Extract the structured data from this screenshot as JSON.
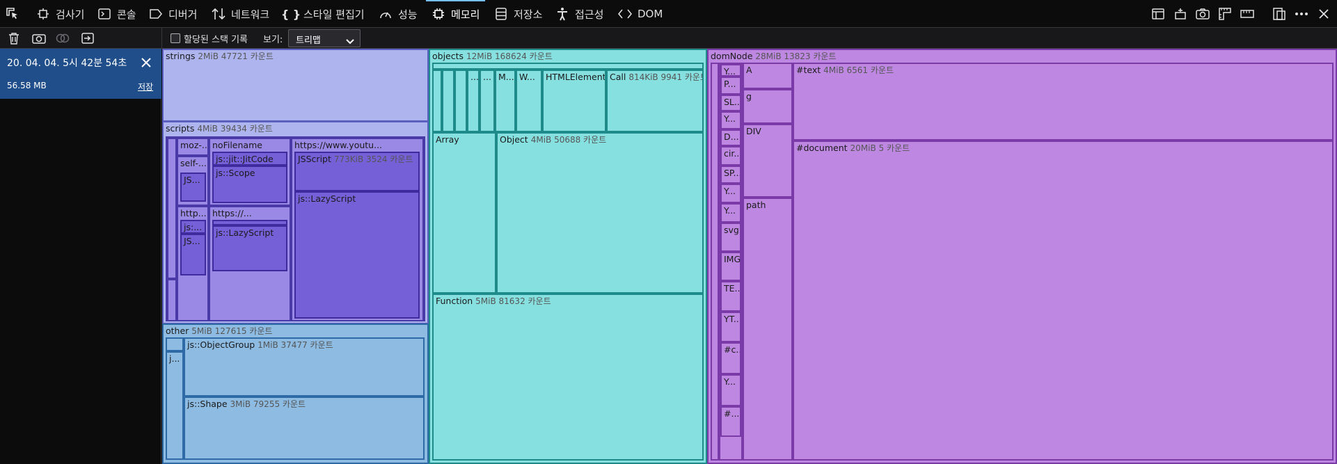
{
  "toolbar": {
    "tabs": [
      {
        "label": "검사기",
        "icon": "inspector-icon"
      },
      {
        "label": "콘솔",
        "icon": "console-icon"
      },
      {
        "label": "디버거",
        "icon": "debugger-icon"
      },
      {
        "label": "네트워크",
        "icon": "network-icon"
      },
      {
        "label": "스타일 편집기",
        "icon": "style-editor-icon"
      },
      {
        "label": "성능",
        "icon": "performance-icon"
      },
      {
        "label": "메모리",
        "icon": "memory-icon"
      },
      {
        "label": "저장소",
        "icon": "storage-icon"
      },
      {
        "label": "접근성",
        "icon": "accessibility-icon"
      },
      {
        "label": "DOM",
        "icon": "dom-icon"
      }
    ],
    "active_tab": "메모리"
  },
  "subbar": {
    "record_stacks_label": "할당된 스택 기록",
    "view_label": "보기:",
    "view_selected": "트리맵"
  },
  "snapshot": {
    "title": "20. 04. 04. 5시 42분 54초",
    "size": "56.58 MB",
    "save_label": "저장"
  },
  "treemap": {
    "strings": {
      "name": "strings",
      "size": "2MiB 47721 카운트"
    },
    "scripts": {
      "name": "scripts",
      "size": "4MiB 39434 카운트",
      "moz": "moz-...",
      "self": "self-...",
      "self_js": "JS...",
      "http": "http...",
      "http_js1": "js:...",
      "http_js2": "JS...",
      "nofilename": "noFilename",
      "jitcode": "js::jit::JitCode",
      "scope": "js::Scope",
      "https_short": "https://...",
      "lazy1": "js::LazyScript",
      "youtube": "https://www.youtu...",
      "jsscript": "JSScript",
      "jsscript_size": "773KiB 3524 카운트",
      "lazy2": "js::LazyScript"
    },
    "other": {
      "name": "other",
      "size": "5MiB 127615 카운트",
      "j": "j...",
      "objectgroup": "js::ObjectGroup",
      "objectgroup_size": "1MiB 37477 카운트",
      "shape": "js::Shape",
      "shape_size": "3MiB 79255 카운트"
    },
    "objects": {
      "name": "objects",
      "size": "12MiB 168624 카운트",
      "dots1": "...",
      "dots2": "...",
      "m": "M...",
      "w": "W...",
      "htmlelement": "HTMLElement",
      "call": "Call",
      "call_size": "814KiB 9941 카운트",
      "array": "Array",
      "object": "Object",
      "object_size": "4MiB 50688 카운트",
      "function": "Function",
      "function_size": "5MiB 81632 카운트"
    },
    "domnode": {
      "name": "domNode",
      "size": "28MiB 13823 카운트",
      "small": [
        "Y...",
        "P...",
        "SL...",
        "Y...",
        "D...",
        "cir...",
        "SP...",
        "Y...",
        "Y...",
        "svg",
        "IMG",
        "TE...",
        "YT...",
        "#c...",
        "Y...",
        "#..."
      ],
      "a": "A",
      "g": "g",
      "div": "DIV",
      "path": "path",
      "text": "#text",
      "text_size": "4MiB 6561 카운트",
      "document": "#document",
      "document_size": "20MiB 5 카운트"
    }
  }
}
